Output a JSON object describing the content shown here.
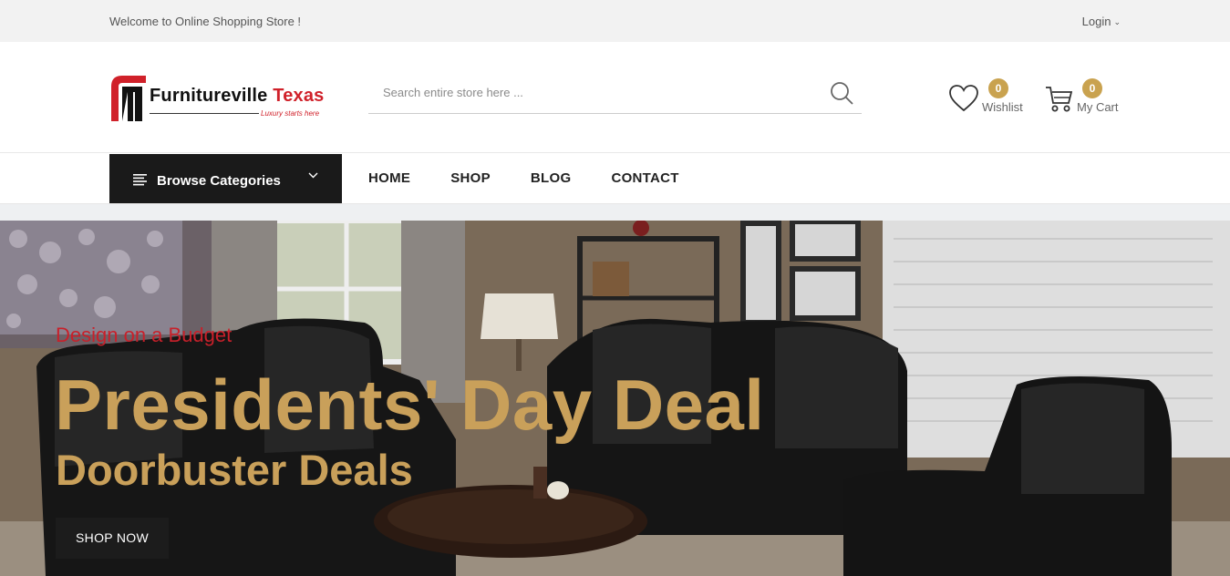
{
  "topbar": {
    "welcome": "Welcome to Online Shopping Store !",
    "login": "Login"
  },
  "header": {
    "logo": {
      "brand_main": "Furnitureville",
      "brand_accent": "Texas",
      "tagline": "Luxury starts here"
    },
    "search": {
      "placeholder": "Search entire store here ..."
    },
    "wishlist": {
      "label": "Wishlist",
      "count": "0"
    },
    "cart": {
      "label": "My Cart",
      "count": "0"
    }
  },
  "nav": {
    "browse_label": "Browse Categories",
    "items": [
      {
        "label": "HOME"
      },
      {
        "label": "SHOP"
      },
      {
        "label": "BLOG"
      },
      {
        "label": "CONTACT"
      }
    ]
  },
  "hero": {
    "kicker": "Design on a Budget",
    "headline": "Presidents' Day Deal",
    "subheadline": "Doorbuster Deals",
    "cta": "SHOP NOW"
  },
  "colors": {
    "accent_gold": "#c9a24f",
    "brand_red": "#d0212a",
    "dark": "#1a1a1a"
  }
}
